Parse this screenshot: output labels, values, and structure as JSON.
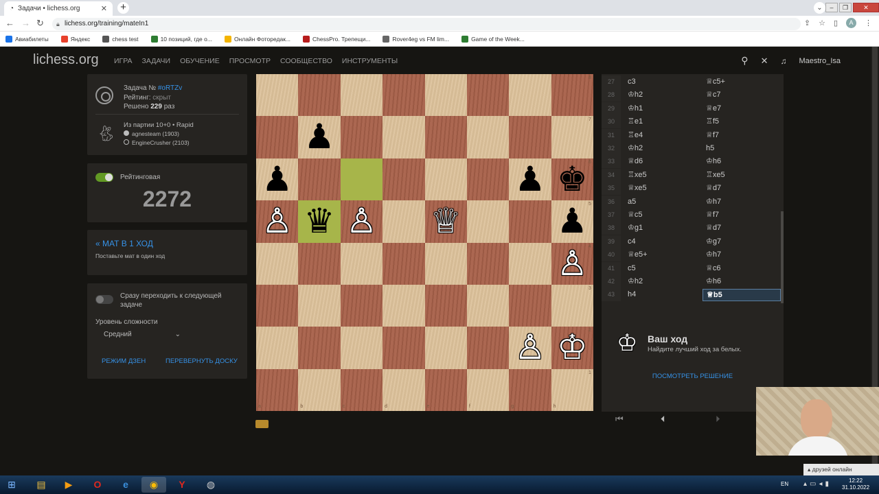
{
  "browser": {
    "tab_title": "Задачи • lichess.org",
    "url": "lichess.org/training/mateIn1",
    "avatar_letter": "A",
    "bookmarks": [
      {
        "label": "Авиабилеты",
        "color": "#1a73e8"
      },
      {
        "label": "Яндекс",
        "color": "#e8412c"
      },
      {
        "label": "chess test",
        "color": "#555555"
      },
      {
        "label": "10 позиций, где о...",
        "color": "#2e7d32"
      },
      {
        "label": "Онлайн Фоторедак...",
        "color": "#f4b400"
      },
      {
        "label": "ChessPro. Трепещи...",
        "color": "#b71c1c"
      },
      {
        "label": "Rover4eg vs FM lim...",
        "color": "#666666"
      },
      {
        "label": "Game of the Week...",
        "color": "#2e7d32"
      }
    ]
  },
  "header": {
    "logo": "lichess.org",
    "nav": [
      "ИГРА",
      "ЗАДАЧИ",
      "ОБУЧЕНИЕ",
      "ПРОСМОТР",
      "СООБЩЕСТВО",
      "ИНСТРУМЕНТЫ"
    ],
    "username": "Maestro_Isa"
  },
  "puzzle": {
    "title_prefix": "Задача №",
    "id": "#oRTZv",
    "rating_label": "Рейтинг:",
    "rating_value": "скрыт",
    "solved_prefix": "Решено",
    "solved_count": "229",
    "solved_suffix": "раз",
    "game_info": "Из партии 10+0 • Rapid",
    "white_player": "agnesteam (1903)",
    "black_player": "EngineCrusher (2103)"
  },
  "rating_box": {
    "toggle_label": "Рейтинговая",
    "rating": "2272"
  },
  "theme": {
    "title": "« МАТ В 1 ХОД",
    "description": "Поставьте мат в один ход"
  },
  "settings": {
    "auto_next_label": "Сразу переходить к следующей задаче",
    "difficulty_label": "Уровень сложности",
    "difficulty_value": "Средний",
    "zen_button": "РЕЖИМ ДЗЕН",
    "flip_button": "ПЕРЕВЕРНУТЬ ДОСКУ"
  },
  "board": {
    "files": [
      "a",
      "b",
      "c",
      "d",
      "e",
      "f",
      "g",
      "h"
    ],
    "ranks": [
      "8",
      "7",
      "6",
      "5",
      "4",
      "3",
      "2",
      "1"
    ],
    "highlight": [
      "c6",
      "b5"
    ],
    "pieces": [
      {
        "sq": "b7",
        "glyph": "♟",
        "color": "b"
      },
      {
        "sq": "a6",
        "glyph": "♟",
        "color": "b"
      },
      {
        "sq": "g6",
        "glyph": "♟",
        "color": "b"
      },
      {
        "sq": "h6",
        "glyph": "♚",
        "color": "b"
      },
      {
        "sq": "a5",
        "glyph": "♙",
        "color": "w"
      },
      {
        "sq": "b5",
        "glyph": "♛",
        "color": "b"
      },
      {
        "sq": "c5",
        "glyph": "♙",
        "color": "w"
      },
      {
        "sq": "e5",
        "glyph": "♕",
        "color": "w"
      },
      {
        "sq": "h5",
        "glyph": "♟",
        "color": "b"
      },
      {
        "sq": "h4",
        "glyph": "♙",
        "color": "w"
      },
      {
        "sq": "g2",
        "glyph": "♙",
        "color": "w"
      },
      {
        "sq": "h2",
        "glyph": "♔",
        "color": "w"
      }
    ]
  },
  "moves": [
    {
      "n": "27",
      "w": "c3",
      "b": "♕c5+"
    },
    {
      "n": "28",
      "w": "♔h2",
      "b": "♕c7"
    },
    {
      "n": "29",
      "w": "♔h1",
      "b": "♕e7"
    },
    {
      "n": "30",
      "w": "♖e1",
      "b": "♖f5"
    },
    {
      "n": "31",
      "w": "♖e4",
      "b": "♕f7"
    },
    {
      "n": "32",
      "w": "♔h2",
      "b": "h5"
    },
    {
      "n": "33",
      "w": "♕d6",
      "b": "♔h6"
    },
    {
      "n": "34",
      "w": "♖xe5",
      "b": "♖xe5"
    },
    {
      "n": "35",
      "w": "♕xe5",
      "b": "♕d7"
    },
    {
      "n": "36",
      "w": "a5",
      "b": "♔h7"
    },
    {
      "n": "37",
      "w": "♕c5",
      "b": "♕f7"
    },
    {
      "n": "38",
      "w": "♔g1",
      "b": "♕d7"
    },
    {
      "n": "39",
      "w": "c4",
      "b": "♔g7"
    },
    {
      "n": "40",
      "w": "♕e5+",
      "b": "♔h7"
    },
    {
      "n": "41",
      "w": "c5",
      "b": "♕c6"
    },
    {
      "n": "42",
      "w": "♔h2",
      "b": "♔h6"
    },
    {
      "n": "43",
      "w": "h4",
      "b": "♕b5"
    }
  ],
  "your_move": {
    "title": "Ваш ход",
    "subtitle": "Найдите лучший ход за белых.",
    "solution_button": "ПОСМОТРЕТЬ РЕШЕНИЕ"
  },
  "taskbar": {
    "lang": "EN",
    "time": "12:22",
    "date": "31.10.2022",
    "friends_popup": "друзей онлайн"
  }
}
